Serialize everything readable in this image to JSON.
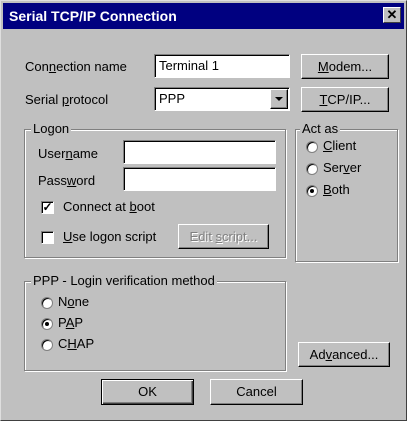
{
  "window": {
    "title": "Serial TCP/IP Connection",
    "close_glyph": "✕"
  },
  "connection": {
    "name_label_pre": "Con",
    "name_label_key": "n",
    "name_label_post": "ection name",
    "name_value": "Terminal 1",
    "protocol_label_pre": "Serial ",
    "protocol_label_key": "p",
    "protocol_label_post": "rotocol",
    "protocol_value": "PPP"
  },
  "buttons": {
    "modem_key": "M",
    "modem_rest": "odem...",
    "tcpip_key": "T",
    "tcpip_rest": "CP/IP...",
    "advanced_pre": "Ad",
    "advanced_key": "v",
    "advanced_post": "anced...",
    "ok": "OK",
    "cancel": "Cancel"
  },
  "logon": {
    "group_title": "Logon",
    "username_pre": "User",
    "username_key": "n",
    "username_post": "ame",
    "username_value": "",
    "password_pre": "Pass",
    "password_key": "w",
    "password_post": "ord",
    "password_value": "",
    "connect_at_boot_pre": "Connect at ",
    "connect_at_boot_key": "b",
    "connect_at_boot_post": "oot",
    "connect_at_boot_checked": true,
    "use_logon_script_key": "U",
    "use_logon_script_post": "se logon script",
    "use_logon_script_checked": false,
    "edit_script_pre": "Edit ",
    "edit_script_key": "s",
    "edit_script_post": "cript..."
  },
  "act_as": {
    "group_title": "Act as",
    "options": [
      {
        "key": "C",
        "post": "lient",
        "pre": "",
        "selected": false
      },
      {
        "pre": "Ser",
        "key": "v",
        "post": "er",
        "selected": false
      },
      {
        "key": "B",
        "post": "oth",
        "pre": "",
        "selected": true
      }
    ]
  },
  "ppp": {
    "group_title": "PPP - Login verification method",
    "options": [
      {
        "pre": "N",
        "key": "o",
        "post": "ne",
        "selected": false
      },
      {
        "pre": "P",
        "key": "A",
        "post": "P",
        "selected": true
      },
      {
        "pre": "C",
        "key": "H",
        "post": "AP",
        "selected": false
      }
    ]
  },
  "colors": {
    "titlebar": "#000080",
    "face": "#c0c0c0",
    "disabled_text": "#808080"
  }
}
